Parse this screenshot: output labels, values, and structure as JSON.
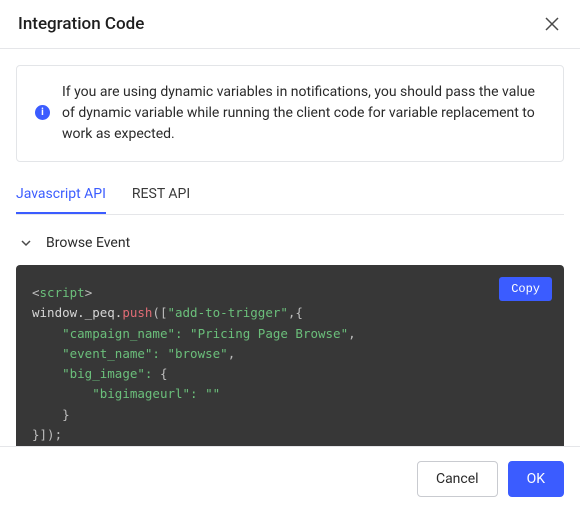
{
  "header": {
    "title": "Integration Code"
  },
  "info": {
    "text": "If you are using dynamic variables in notifications, you should pass the value of dynamic variable while running the client code for variable replacement to work as expected."
  },
  "tabs": {
    "js": "Javascript API",
    "rest": "REST API"
  },
  "accordion": {
    "label": "Browse Event"
  },
  "code": {
    "copy_label": "Copy",
    "tokens": {
      "lt": "<",
      "gt": ">",
      "script_tag": "script",
      "window_peq": "window._peq.",
      "push": "push",
      "open_args": "([",
      "trigger_str": "\"add-to-trigger\"",
      "comma_brace": ",{",
      "campaign_key": "\"campaign_name\":",
      "campaign_val": " \"Pricing Page Browse\"",
      "comma": ",",
      "event_key": "\"event_name\":",
      "event_val": " \"browse\"",
      "bigimg_key": "\"big_image\":",
      "open_obj": " {",
      "bigurl_key": "\"bigimageurl\":",
      "bigurl_val": " \"\"",
      "close_brace": "}",
      "close_all": "}]);"
    }
  },
  "footer": {
    "cancel": "Cancel",
    "ok": "OK"
  }
}
